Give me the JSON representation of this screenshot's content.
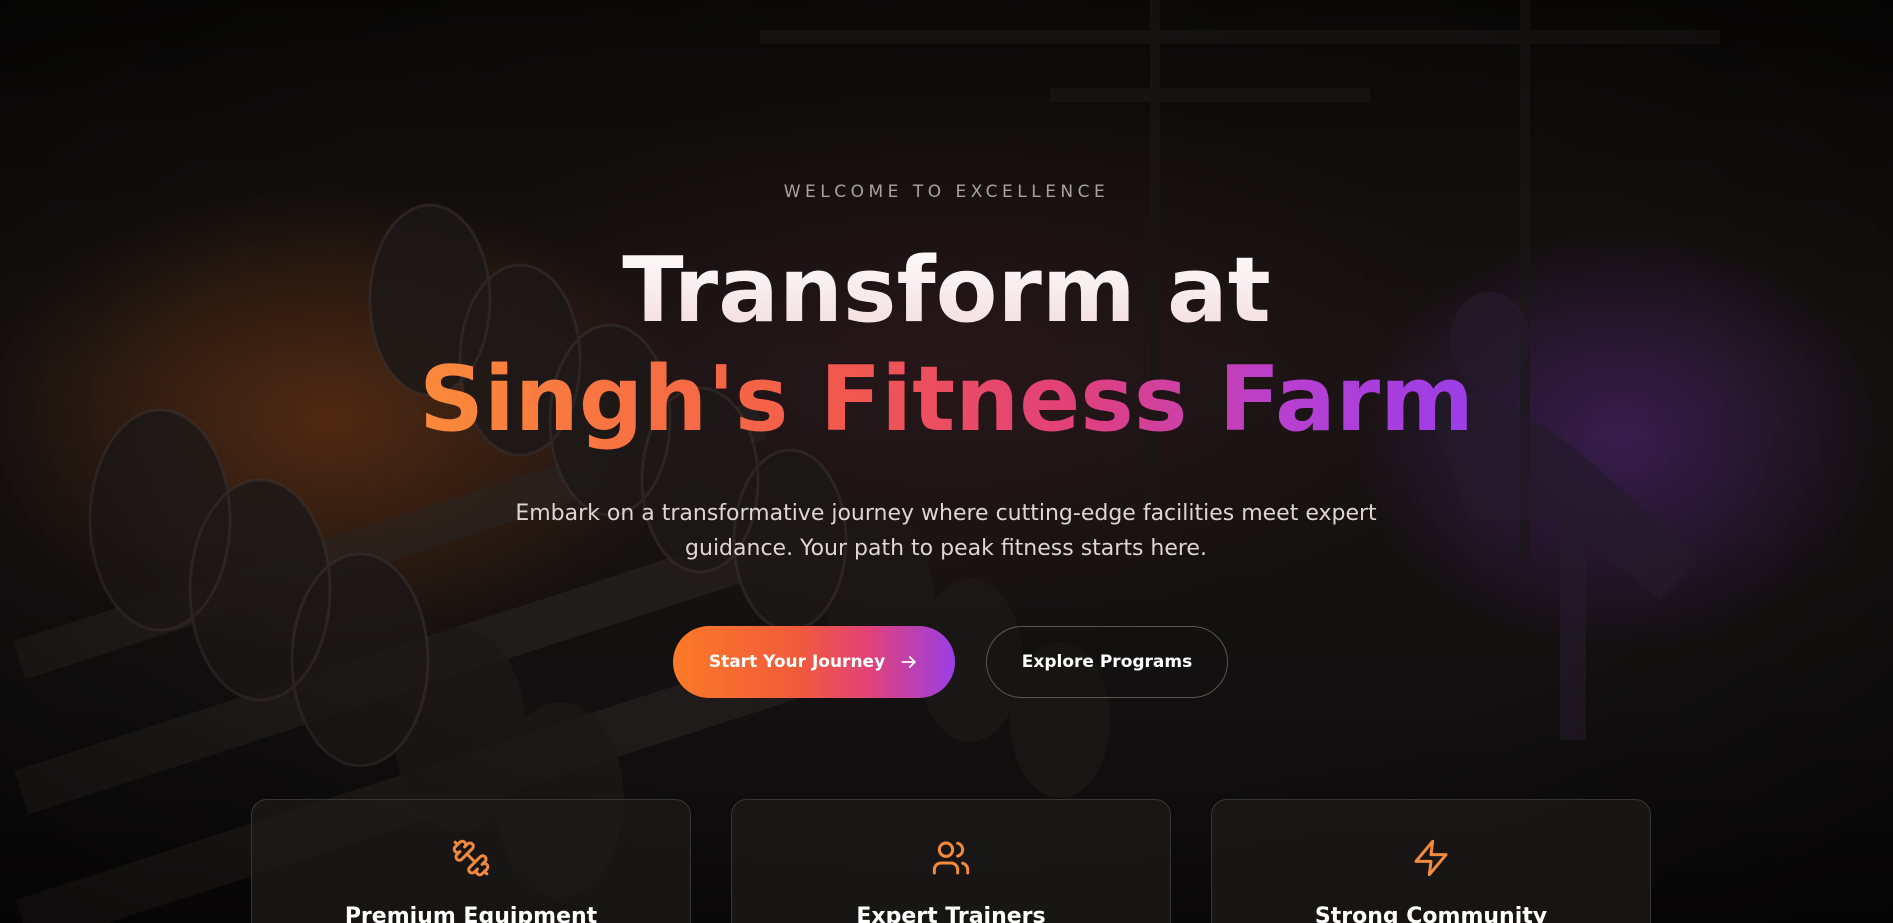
{
  "hero": {
    "eyebrow": "WELCOME TO EXCELLENCE",
    "title_line1": "Transform at",
    "title_line2": "Singh's Fitness Farm",
    "subtitle": "Embark on a transformative journey where cutting-edge facilities meet expert guidance. Your path to peak fitness starts here.",
    "primary_button": "Start Your Journey",
    "secondary_button": "Explore Programs"
  },
  "features": [
    {
      "title": "Premium Equipment",
      "icon": "dumbbell-icon"
    },
    {
      "title": "Expert Trainers",
      "icon": "users-icon"
    },
    {
      "title": "Strong Community",
      "icon": "lightning-icon"
    }
  ],
  "colors": {
    "accent_orange": "#fb8a3a",
    "accent_pink": "#e2407a",
    "accent_purple": "#9b3ee8",
    "icon_orange": "#f28a3c"
  }
}
